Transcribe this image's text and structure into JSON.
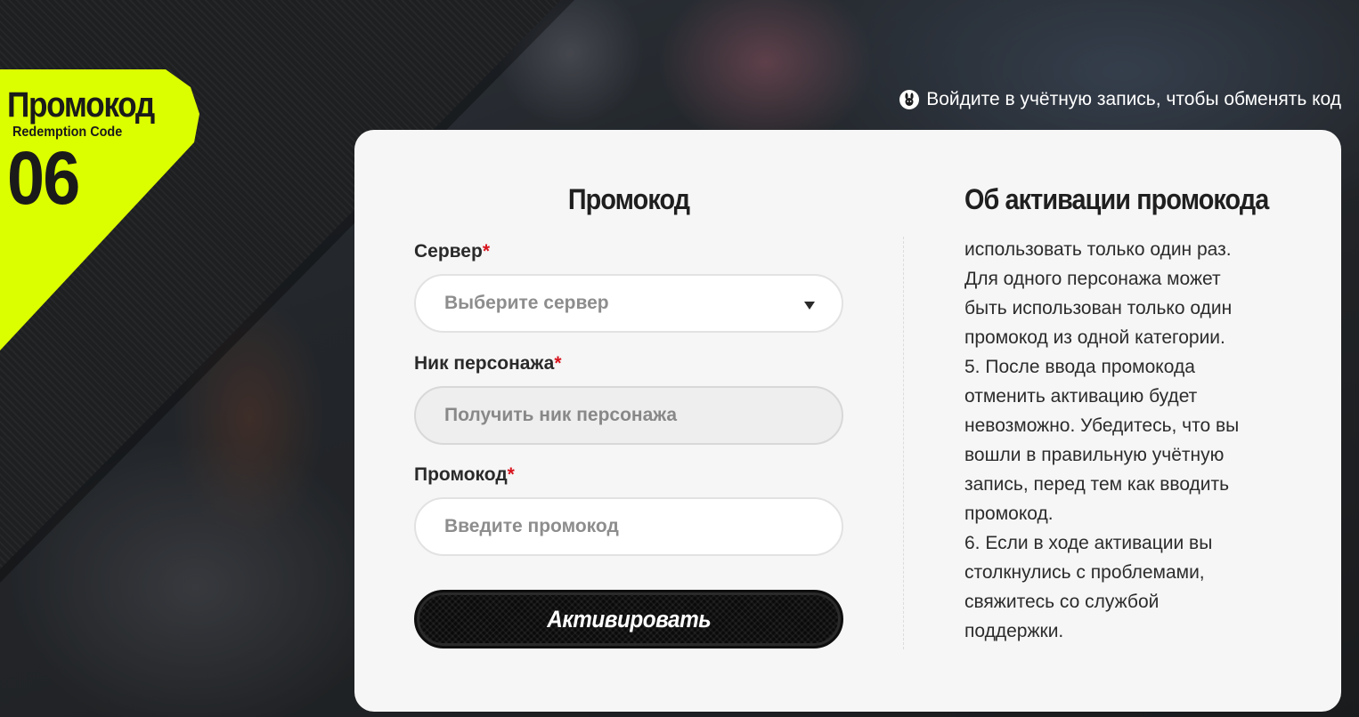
{
  "badge": {
    "title": "Промокод",
    "subtitle": "Redemption Code",
    "number": "06"
  },
  "login": {
    "text": "Войдите в учётную запись, чтобы обменять код",
    "icon": "bunny-icon"
  },
  "form": {
    "title": "Промокод",
    "required_mark": "*",
    "server": {
      "label": "Сервер",
      "placeholder": "Выберите сервер"
    },
    "nickname": {
      "label": "Ник персонажа",
      "placeholder": "Получить ник персонажа"
    },
    "code": {
      "label": "Промокод",
      "placeholder": "Введите промокод"
    },
    "submit_label": "Активировать"
  },
  "info": {
    "title": "Об активации промокода",
    "lines": [
      "использовать только один раз.",
      "Для одного персонажа может",
      "быть использован только один",
      "промокод из одной категории.",
      "5. После ввода промокода",
      "отменить активацию будет",
      "невозможно. Убедитесь, что вы",
      "вошли в правильную учётную",
      "запись, перед тем как вводить",
      "промокод.",
      "6. Если в ходе активации вы",
      "столкнулись с проблемами,",
      "свяжитесь со службой",
      "поддержки."
    ]
  },
  "colors": {
    "accent": "#dcff00",
    "required": "#d8141e",
    "card": "#f6f6f6"
  }
}
